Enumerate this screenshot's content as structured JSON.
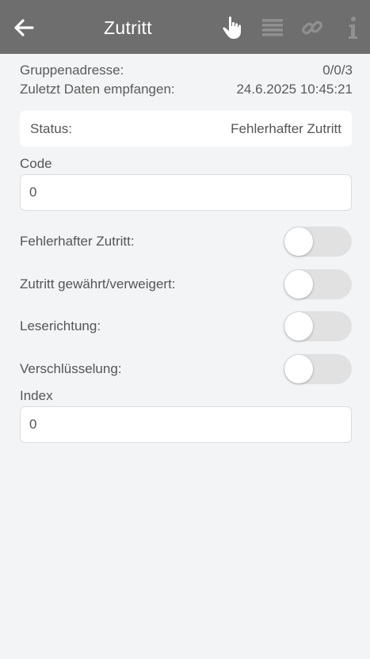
{
  "header": {
    "title": "Zutritt",
    "icons": [
      "back-arrow-icon",
      "hand-pointer-icon",
      "list-icon",
      "link-icon",
      "info-icon"
    ],
    "background": "#6e6e6e"
  },
  "info": {
    "group_address_label": "Gruppenadresse:",
    "group_address_value": "0/0/3",
    "last_data_label": "Zuletzt Daten empfangen:",
    "last_data_value": "24.6.2025 10:45:21"
  },
  "status": {
    "label": "Status:",
    "value": "Fehlerhafter Zutritt"
  },
  "code": {
    "label": "Code",
    "value": "0"
  },
  "toggles": [
    {
      "label": "Fehlerhafter Zutritt:",
      "on": false
    },
    {
      "label": "Zutritt gewährt/verweigert:",
      "on": false
    },
    {
      "label": "Leserichtung:",
      "on": false
    },
    {
      "label": "Verschlüsselung:",
      "on": false
    }
  ],
  "index": {
    "label": "Index",
    "value": "0"
  }
}
